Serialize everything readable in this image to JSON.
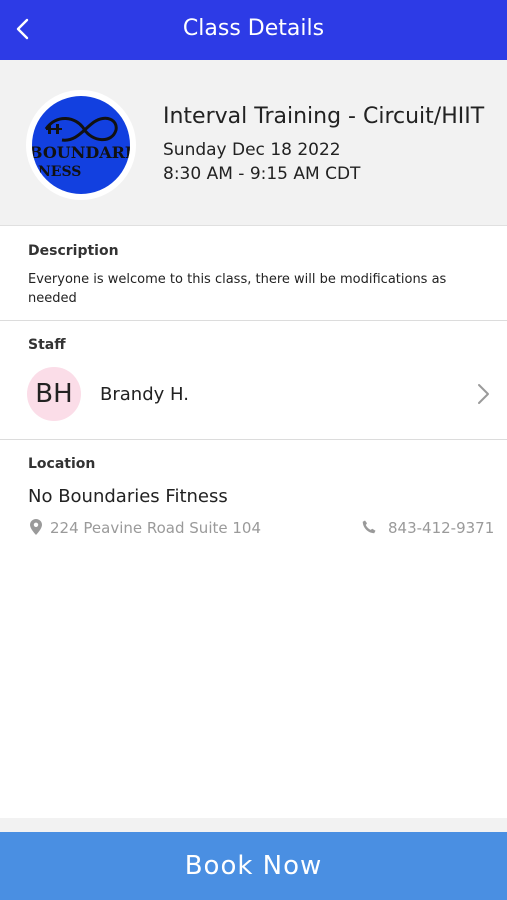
{
  "header": {
    "title": "Class Details",
    "back_icon": "chevron-left-icon",
    "background_color": "#2d3be6"
  },
  "class_info": {
    "logo_text_line1": "BOUNDARI",
    "logo_text_line2": "NESS",
    "name": "Interval Training - Circuit/HIIT",
    "date": "Sunday Dec 18 2022",
    "time": "8:30 AM - 9:15 AM CDT"
  },
  "description": {
    "label": "Description",
    "text": "Everyone is welcome to this class, there will be modifications as needed"
  },
  "staff": {
    "label": "Staff",
    "initials": "BH",
    "name": "Brandy H.",
    "avatar_color": "#fbdde8"
  },
  "location": {
    "label": "Location",
    "name": "No Boundaries Fitness",
    "address": "224 Peavine Road Suite 104",
    "phone": "843-412-9371"
  },
  "footer": {
    "book_label": "Book Now",
    "button_color": "#4a8fe2"
  }
}
